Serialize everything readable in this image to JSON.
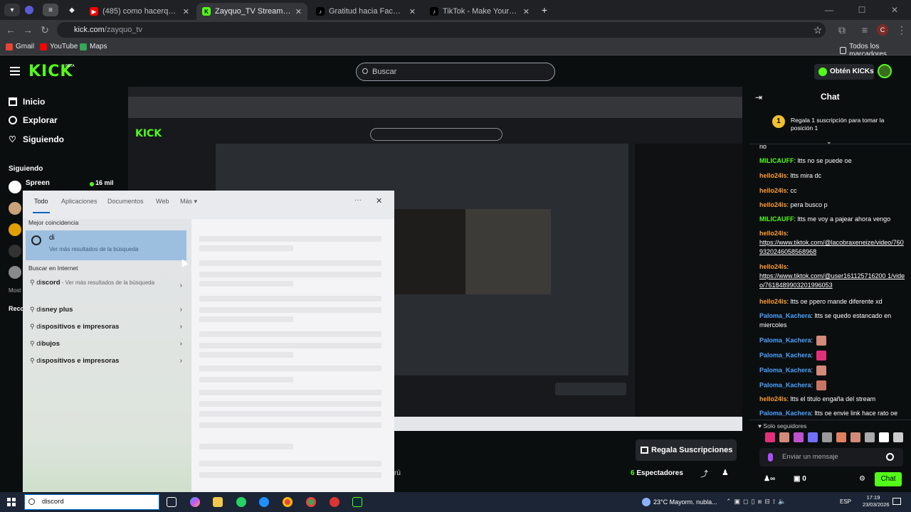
{
  "browser": {
    "tabs": [
      {
        "title": "(485) como hacerque mi chat n",
        "favicon": "youtube-icon"
      },
      {
        "title": "Zayquo_TV Stream - Watch Liv",
        "favicon": "kick-icon",
        "active": true
      },
      {
        "title": "Gratitud hacia Facu: Siempre e",
        "favicon": "tiktok-icon"
      },
      {
        "title": "TikTok - Make Your Day",
        "favicon": "tiktok-icon"
      }
    ],
    "url_domain": "kick.com",
    "url_path": "/zayquo_tv",
    "profile_letter": "C",
    "bookmarks": [
      {
        "label": "Gmail",
        "color": "#ea4335"
      },
      {
        "label": "YouTube",
        "color": "#ff0000"
      },
      {
        "label": "Maps",
        "color": "#34a853"
      }
    ],
    "all_bookmarks": "Todos los marcadores"
  },
  "kick": {
    "logo": "KICK",
    "beta": "BETA",
    "search_placeholder": "Buscar",
    "kicks_button": "Obtén KICKs",
    "nav": [
      {
        "label": "Inicio",
        "icon": "home-icon"
      },
      {
        "label": "Explorar",
        "icon": "compass-icon"
      },
      {
        "label": "Siguiendo",
        "icon": "heart-icon"
      }
    ],
    "following_header": "Siguiendo",
    "followed_channel": {
      "name": "Spreen",
      "viewers": "16 mil"
    },
    "side_labels": {
      "most": "Most",
      "reco": "Reco"
    },
    "bottom": {
      "gift_subs": "Regala Suscripciones",
      "viewers_count": "6",
      "viewers_label": "Espectadores",
      "partial_label": "rú"
    }
  },
  "chat": {
    "title": "Chat",
    "pinned": {
      "rank": "1",
      "text": "Regala 1 suscripción para tomar la posición 1"
    },
    "cut_first": "no",
    "messages": [
      {
        "user": "MILICAUFF",
        "color": "#53fc18",
        "text": "ltts no se puede oe"
      },
      {
        "user": "hello24ls",
        "color": "#ff9d2e",
        "text": "ltts mira dc"
      },
      {
        "user": "hello24ls",
        "color": "#ff9d2e",
        "text": "cc"
      },
      {
        "user": "hello24ls",
        "color": "#ff9d2e",
        "text": "pera busco p"
      },
      {
        "user": "MILICAUFF",
        "color": "#53fc18",
        "text": "ltts me voy a pajear ahora vengo"
      },
      {
        "user": "hello24ls",
        "color": "#ff9d2e",
        "link": "https://www.tiktok.com/@lacobraxeneize/video/7609320246058568968"
      },
      {
        "user": "hello24ls",
        "color": "#ff9d2e",
        "link": "https://www.tiktok.com/@user161125716200 1/video/7618489903201996053"
      },
      {
        "user": "hello24ls",
        "color": "#ff9d2e",
        "text": "ltts oe ppero mande diferente xd"
      },
      {
        "user": "Paloma_Kachera",
        "color": "#4da3ff",
        "text": "ltts se quedo estancado en miercoles"
      },
      {
        "user": "Paloma_Kachera",
        "color": "#4da3ff",
        "emote": true
      },
      {
        "user": "Paloma_Kachera",
        "color": "#4da3ff",
        "emote": true
      },
      {
        "user": "Paloma_Kachera",
        "color": "#4da3ff",
        "emote": true
      },
      {
        "user": "Paloma_Kachera",
        "color": "#4da3ff",
        "emote": true
      },
      {
        "user": "hello24ls",
        "color": "#ff9d2e",
        "text": "ltts el titulo engaña del stream"
      },
      {
        "user": "Paloma_Kachera",
        "color": "#4da3ff",
        "text": "ltts oe envie link hace rato oe"
      }
    ],
    "followers_only": "Solo seguidores",
    "input_placeholder": "Enviar un mensaje",
    "points": "0",
    "send_button": "Chat"
  },
  "start_menu": {
    "tabs": [
      "Todo",
      "Aplicaciones",
      "Documentos",
      "Web",
      "Más"
    ],
    "best_match_header": "Mejor coincidencia",
    "best_match": {
      "term": "di",
      "sub": "Ver más resultados de la búsqueda"
    },
    "web_header": "Buscar en Internet",
    "suggestions": [
      {
        "bold": "di",
        "rest": "scord",
        "sub": " - Ver más resultados de la búsqueda"
      },
      {
        "bold": "di",
        "rest": "sney plus",
        "sub": ""
      },
      {
        "bold": "di",
        "rest": "spositivos e impresoras",
        "sub": ""
      },
      {
        "bold": "di",
        "rest": "bujos",
        "sub": ""
      },
      {
        "bold": "di",
        "rest": "spositivos e impresoras",
        "sub": ""
      }
    ],
    "search_text": "discord"
  },
  "taskbar": {
    "weather": "23°C  Mayorm. nubla...",
    "lang": "ESP",
    "time": "17:19",
    "date": "23/03/2026"
  }
}
